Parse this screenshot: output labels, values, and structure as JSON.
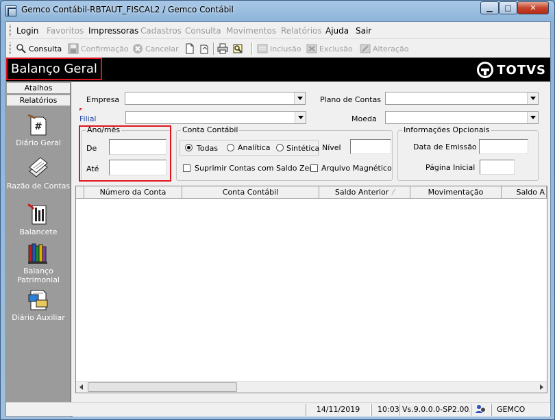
{
  "window": {
    "title": "Gemco Contábil-RBTAUT_FISCAL2 / Gemco Contábil"
  },
  "menu": [
    {
      "label": "Login",
      "enabled": true
    },
    {
      "label": "Favoritos",
      "enabled": false
    },
    {
      "label": "Impressoras",
      "enabled": true
    },
    {
      "label": "Cadastros",
      "enabled": false
    },
    {
      "label": "Consulta",
      "enabled": false
    },
    {
      "label": "Movimentos",
      "enabled": false
    },
    {
      "label": "Relatórios",
      "enabled": false
    },
    {
      "label": "Ajuda",
      "enabled": true
    },
    {
      "label": "Sair",
      "enabled": true
    }
  ],
  "toolbar": {
    "consulta": "Consulta",
    "confirmacao": "Confirmação",
    "cancelar": "Cancelar",
    "inclusao": "Inclusão",
    "exclusao": "Exclusão",
    "alteracao": "Alteração"
  },
  "header": {
    "title": "Balanço Geral",
    "logo": "TOTVS"
  },
  "sidebar": {
    "tabs": [
      "Atalhos",
      "Relatórios"
    ],
    "items": [
      {
        "label": "Diário Geral",
        "icon": "journal-icon"
      },
      {
        "label": "Razão de Contas",
        "icon": "ledger-icon"
      },
      {
        "label": "Balancete",
        "icon": "balancete-icon"
      },
      {
        "label": "Balanço Patrimonial",
        "icon": "books-icon"
      },
      {
        "label": "Diário Auxiliar",
        "icon": "auxiliary-icon"
      }
    ]
  },
  "form": {
    "empresa_label": "Empresa",
    "filial_label": "Filial",
    "plano_label": "Plano de Contas",
    "moeda_label": "Moeda",
    "anomes": {
      "title": "Ano/mês",
      "de": "De",
      "ate": "Até"
    },
    "conta": {
      "title": "Conta Contábil",
      "todas": "Todas",
      "analitica": "Analítica",
      "sintetica": "Sintética",
      "selected": "Todas",
      "nivel": "Nível",
      "suprimir": "Suprimir Contas com Saldo Zero",
      "arquivo": "Arquivo Magnético"
    },
    "info": {
      "title": "Informações Opcionais",
      "data": "Data de Emissão",
      "pagina": "Página Inicial"
    }
  },
  "grid": {
    "columns": [
      "Número da Conta",
      "Conta Contábil",
      "Saldo Anterior",
      "Movimentação",
      "Saldo A"
    ]
  },
  "status": {
    "date": "14/11/2019",
    "time": "10:03",
    "version": "Vs.9.0.0.0-SP2.00.0",
    "user": "GEMCO"
  },
  "colors": {
    "accent": "#e0141f",
    "header": "#000000",
    "sidebar": "#9b9b9b"
  }
}
